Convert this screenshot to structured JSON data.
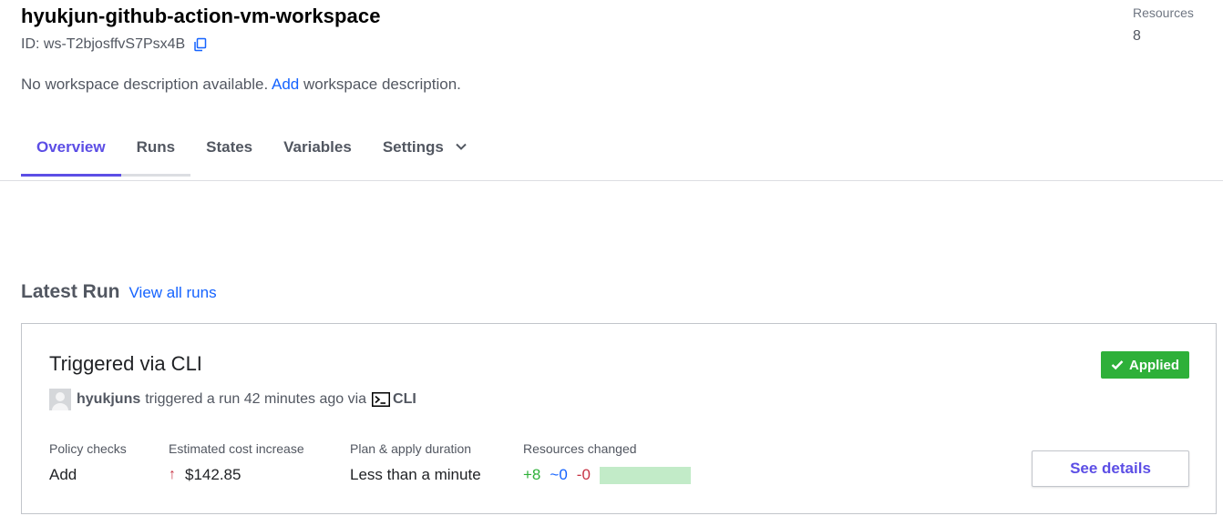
{
  "workspace": {
    "title": "hyukjun-github-action-vm-workspace",
    "id_label": "ID:",
    "id_value": "ws-T2bjosffvS7Psx4B",
    "description_prefix": "No workspace description available.",
    "description_link": "Add",
    "description_suffix": "workspace description."
  },
  "resources": {
    "label": "Resources",
    "value": "8"
  },
  "tabs": [
    {
      "label": "Overview",
      "active": true
    },
    {
      "label": "Runs",
      "active": false
    },
    {
      "label": "States",
      "active": false
    },
    {
      "label": "Variables",
      "active": false
    },
    {
      "label": "Settings",
      "active": false
    }
  ],
  "latest_run": {
    "heading": "Latest Run",
    "view_all": "View all runs",
    "title": "Triggered via CLI",
    "status": "Applied",
    "user": "hyukjuns",
    "trigger_text": "triggered a run 42 minutes ago via",
    "source": "CLI",
    "metrics": {
      "policy_label": "Policy checks",
      "policy_value": "Add",
      "cost_label": "Estimated cost increase",
      "cost_value": "$142.85",
      "duration_label": "Plan & apply duration",
      "duration_value": "Less than a minute",
      "resources_label": "Resources changed",
      "added": "+8",
      "changed": "~0",
      "destroyed": "-0"
    },
    "details_button": "See details"
  },
  "colors": {
    "accent": "#5c4ee5",
    "link": "#1563ff",
    "success": "#2eb039",
    "danger": "#c73445"
  },
  "icons": [
    "copy-icon",
    "chevron-down-icon",
    "check-icon",
    "avatar-icon",
    "terminal-icon",
    "arrow-up-icon"
  ]
}
